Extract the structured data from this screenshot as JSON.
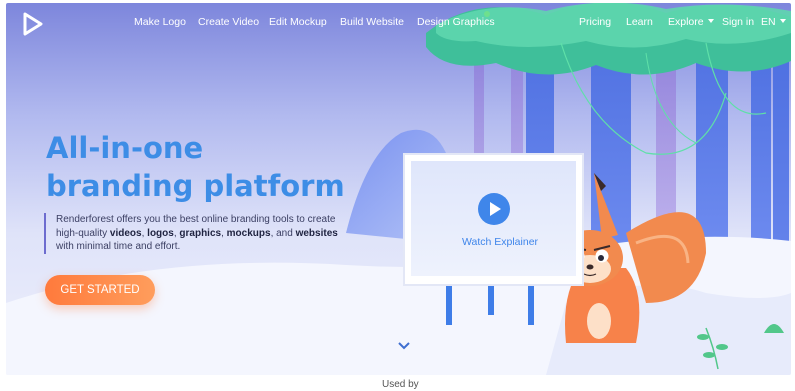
{
  "nav": {
    "logo": "renderforest-logo",
    "links": {
      "make_logo": "Make Logo",
      "create_video": "Create Video",
      "edit_mockup": "Edit Mockup",
      "build_website": "Build Website",
      "design_graphics": "Design Graphics"
    },
    "right": {
      "pricing": "Pricing",
      "learn": "Learn",
      "explore": "Explore",
      "sign_in": "Sign in",
      "language": "EN"
    }
  },
  "hero": {
    "title_line1": "All-in-one",
    "title_line2": "branding platform",
    "desc_intro": "Renderforest offers you the best online branding tools to create high-quality ",
    "desc_videos": "videos",
    "desc_sep1": ", ",
    "desc_logos": "logos",
    "desc_sep2": ", ",
    "desc_graphics": "graphics",
    "desc_sep3": ", ",
    "desc_mockups": "mockups",
    "desc_sep4": ",",
    "desc_and": " and ",
    "desc_websites": "websites",
    "desc_end": " with minimal time and effort.",
    "cta": "GET STARTED",
    "watch": "Watch Explainer"
  },
  "footer": {
    "used_by": "Used by"
  },
  "colors": {
    "accent": "#3d8de6",
    "cta": "#ff7a3c",
    "new_badge": "#6ee08d"
  },
  "icons": [
    "play-icon",
    "chevron-down-icon",
    "caret-down-icon"
  ]
}
